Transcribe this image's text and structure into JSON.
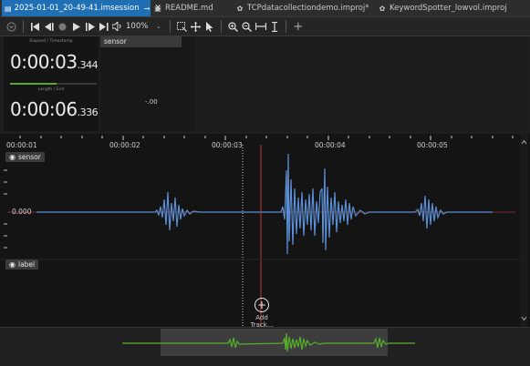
{
  "tabs": [
    {
      "label": "2025-01-01_20-49-41.imsession",
      "active": true,
      "pinned": true,
      "closable": true
    },
    {
      "label": "README.md",
      "active": false
    },
    {
      "label": "TCPdatacollectiondemo.improj*",
      "active": false
    },
    {
      "label": "KeywordSpotter_lowvol.improj",
      "active": false
    }
  ],
  "toolbar": {
    "zoom_value": "100%"
  },
  "timer": {
    "elapsed_label": "Elapsed / Timestamp",
    "elapsed_main": "0:00:03",
    "elapsed_ms": ".344",
    "length_label": "Length / End",
    "length_main": "0:00:06",
    "length_ms": ".336",
    "progress_fraction": 0.54
  },
  "sensor_panel": {
    "tab_label": "sensor",
    "value": "-.00"
  },
  "timeline": {
    "ticks": [
      "00:00:01",
      "00:00:02",
      "00:00:03",
      "00:00:04",
      "00:00:05"
    ],
    "tracks": [
      {
        "name": "sensor",
        "axis_value": "0.000"
      },
      {
        "name": "label"
      }
    ],
    "add_track_label": "Add Track..."
  },
  "colors": {
    "accent_tab": "#1f6fb5",
    "waveform": "#5b8fd6",
    "overview_wave": "#55b02c",
    "playhead": "#c0392b"
  }
}
